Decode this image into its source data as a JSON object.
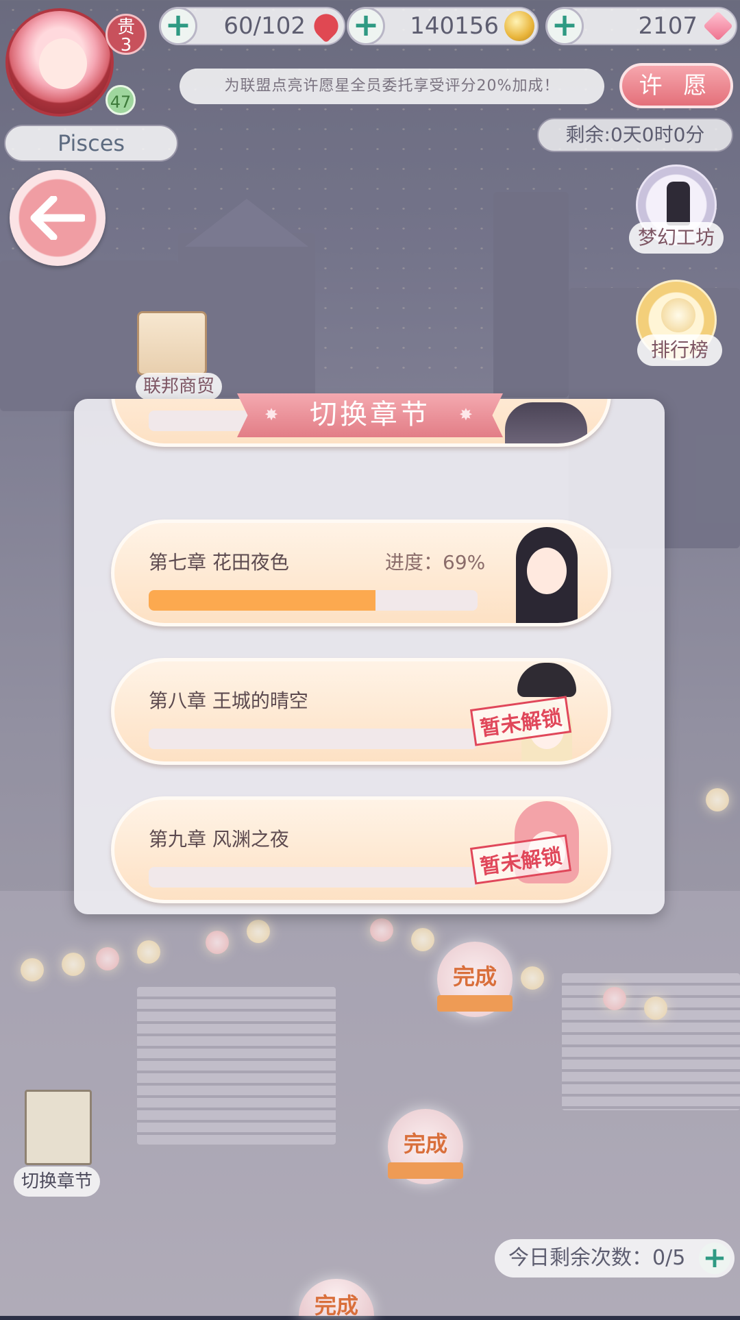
{
  "hud": {
    "vip_label": "贵",
    "vip_level": "3",
    "player_level": "47",
    "player_name": "Pisces",
    "stamina": "60/102",
    "coins": "140156",
    "gems": "2107",
    "banner_text": "为联盟点亮许愿星全员委托享受评分20%加成！",
    "wish_button": "许 愿",
    "time_remaining": "剩余:0天0时0分"
  },
  "side_menu": {
    "dream_workshop": "梦幻工坊",
    "leaderboard": "排行榜",
    "federation_shop": "联邦商贸"
  },
  "dialog": {
    "title": "切换章节",
    "chapters": [
      {
        "label": "第七章  花田夜色",
        "progress_text": "进度：69%",
        "progress": 0.69,
        "locked": false
      },
      {
        "label": "第八章  王城的晴空",
        "progress_text": "",
        "progress": 0,
        "locked": true,
        "lock_text": "暂未解锁"
      },
      {
        "label": "第九章  风渊之夜",
        "progress_text": "",
        "progress": 0,
        "locked": true,
        "lock_text": "暂未解锁"
      }
    ]
  },
  "bottom": {
    "switch_chapter": "切换章节",
    "daily_remaining": "今日剩余次数：0/5",
    "done_label": "完成"
  },
  "colors": {
    "accent_pink": "#e27d86",
    "progress_orange": "#fca94f",
    "plus_green": "#2f9a83"
  }
}
